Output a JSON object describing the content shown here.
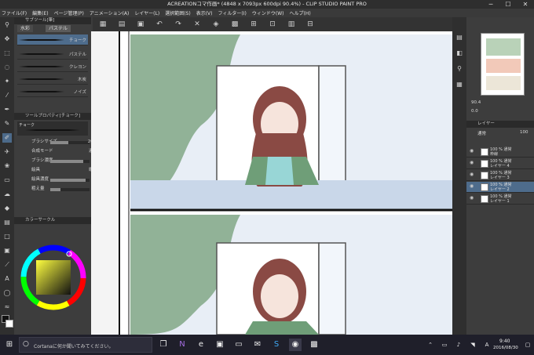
{
  "window": {
    "title": "ACREATIONコマ作画* (4848 x 7093px 600dpi 90.4%) - CLIP STUDIO PAINT PRO",
    "minimize": "─",
    "maximize": "☐",
    "close": "✕"
  },
  "menu": [
    "ファイル(F)",
    "編集(E)",
    "ページ管理(P)",
    "アニメーション(A)",
    "レイヤー(L)",
    "選択範囲(S)",
    "表示(V)",
    "フィルター(I)",
    "ウィンドウ(W)",
    "ヘルプ(H)"
  ],
  "command_bar": {
    "icons": [
      "new-icon",
      "open-icon",
      "save-icon",
      "undo-icon",
      "redo-icon",
      "clear-icon",
      "transform-icon",
      "fill-icon",
      "ruler-icon",
      "snap-icon",
      "grid-icon",
      "guide-icon"
    ]
  },
  "sub_tool_panel": {
    "header": "サブツール[筆]",
    "tabs": [
      "水彩",
      "パステル"
    ],
    "brushes": [
      "チョーク",
      "パステル",
      "クレヨン",
      "木炭",
      "ノイズ"
    ]
  },
  "tool_property": {
    "header": "ツールプロパティ[チョーク]",
    "tool_name": "チョーク",
    "rows": [
      {
        "label": "ブラシサイズ",
        "value": "20.0",
        "fill": 0.45
      },
      {
        "label": "合成モード",
        "value": "通常",
        "fill": null
      },
      {
        "label": "ブラシ濃度",
        "value": "83",
        "fill": 0.83
      },
      {
        "label": "絵具",
        "value": "縦目",
        "fill": null
      },
      {
        "label": "絵具濃度",
        "value": "90",
        "fill": 0.9
      },
      {
        "label": "粗え量",
        "value": "25",
        "fill": 0.25
      }
    ]
  },
  "color_panel": {
    "header": "カラーサークル",
    "main_color": "#111111",
    "sub_color": "#ffffff"
  },
  "navigator": {
    "zoom": "90.4",
    "angle": "0.0"
  },
  "layer_panel": {
    "header": "レイヤー",
    "blend_mode": "通常",
    "opacity": "100",
    "layers": [
      {
        "line1": "100 % 通常",
        "line2": "枠線"
      },
      {
        "line1": "100 % 通常",
        "line2": "レイヤー 4"
      },
      {
        "line1": "100 % 通常",
        "line2": "レイヤー 3"
      },
      {
        "line1": "100 % 通常",
        "line2": "レイヤー 2"
      },
      {
        "line1": "100 % 通常",
        "line2": "レイヤー 1"
      }
    ]
  },
  "taskbar": {
    "search_text": "Cortanaに何か聞いてみてください。",
    "time": "9:40",
    "date": "2016/08/30",
    "ime": "A"
  }
}
